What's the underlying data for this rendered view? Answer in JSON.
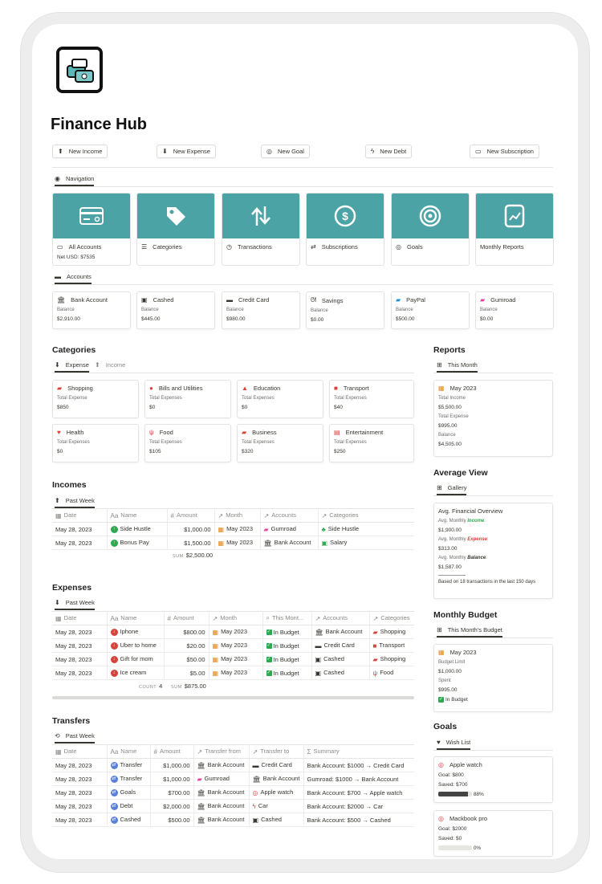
{
  "page": {
    "title": "Finance Hub"
  },
  "quick_actions": [
    {
      "label": "New Income",
      "icon": "arrow-up-circle-icon"
    },
    {
      "label": "New Expense",
      "icon": "arrow-down-circle-icon"
    },
    {
      "label": "New Goal",
      "icon": "target-icon"
    },
    {
      "label": "New Debt",
      "icon": "lightning-icon"
    },
    {
      "label": "New Subscription",
      "icon": "card-icon"
    }
  ],
  "navigation": {
    "tab": "Navigation",
    "cards": [
      {
        "title": "All Accounts",
        "sub": "Net USD:  $7535",
        "icon": "credit-card-icon"
      },
      {
        "title": "Categories",
        "sub": "",
        "icon": "tag-icon"
      },
      {
        "title": "Transactions",
        "sub": "",
        "icon": "arrows-updown-icon"
      },
      {
        "title": "Subscriptions",
        "sub": "",
        "icon": "dollar-cycle-icon"
      },
      {
        "title": "Goals",
        "sub": "",
        "icon": "target-icon"
      },
      {
        "title": "Monthly Reports",
        "sub": "",
        "icon": "report-icon"
      }
    ]
  },
  "accounts": {
    "tab": "Accounts",
    "label": "Balance",
    "items": [
      {
        "name": "Bank Account",
        "balance": "$2,910.00"
      },
      {
        "name": "Cashed",
        "balance": "$445.00"
      },
      {
        "name": "Credit Card",
        "balance": "$980.00"
      },
      {
        "name": "Savings",
        "balance": "$0.00"
      },
      {
        "name": "PayPal",
        "balance": "$500.00"
      },
      {
        "name": "Gumroad",
        "balance": "$0.00"
      }
    ]
  },
  "categories": {
    "title": "Categories",
    "tabs": [
      "Expense",
      "Income"
    ],
    "items": [
      {
        "name": "Shopping",
        "label": "Total Expense",
        "value": "$850",
        "icon": "bag-icon",
        "color": "#d9423b"
      },
      {
        "name": "Bills and Utilities",
        "label": "Total Expenses",
        "value": "$0",
        "icon": "drop-icon",
        "color": "#d9423b"
      },
      {
        "name": "Education",
        "label": "Total Expenses",
        "value": "$0",
        "icon": "graduation-cap-icon",
        "color": "#d9423b"
      },
      {
        "name": "Transport",
        "label": "Total Expenses",
        "value": "$40",
        "icon": "bus-icon",
        "color": "#d9423b"
      },
      {
        "name": "Health",
        "label": "Total Expenses",
        "value": "$0",
        "icon": "heart-icon",
        "color": "#d9423b"
      },
      {
        "name": "Food",
        "label": "Total Expenses",
        "value": "$105",
        "icon": "fork-knife-icon",
        "color": "#d9423b"
      },
      {
        "name": "Business",
        "label": "Total Expenses",
        "value": "$320",
        "icon": "briefcase-icon",
        "color": "#d9423b"
      },
      {
        "name": "Entertainment",
        "label": "Total Expenses",
        "value": "$250",
        "icon": "film-icon",
        "color": "#d9423b"
      }
    ]
  },
  "incomes": {
    "title": "Incomes",
    "tab": "Past Week",
    "columns": [
      "Date",
      "Name",
      "Amount",
      "Month",
      "Accounts",
      "Categories"
    ],
    "rows": [
      {
        "date": "May 28, 2023",
        "name": "Side Hustle",
        "amount": "$1,000.00",
        "month": "May 2023",
        "account": "Gumroad",
        "category": "Side Hustle"
      },
      {
        "date": "May 28, 2023",
        "name": "Bonus Pay",
        "amount": "$1,500.00",
        "month": "May 2023",
        "account": "Bank Account",
        "category": "Salary"
      }
    ],
    "sum_label": "SUM",
    "sum": "$2,500.00"
  },
  "expenses": {
    "title": "Expenses",
    "tab": "Past Week",
    "columns": [
      "Date",
      "Name",
      "Amount",
      "Month",
      "This Mont...",
      "Accounts",
      "Categories"
    ],
    "rows": [
      {
        "date": "May 28, 2023",
        "name": "Iphone",
        "amount": "$800.00",
        "month": "May 2023",
        "status": "In Budget",
        "account": "Bank Account",
        "category": "Shopping"
      },
      {
        "date": "May 28, 2023",
        "name": "Uber to home",
        "amount": "$20.00",
        "month": "May 2023",
        "status": "In Budget",
        "account": "Credit Card",
        "category": "Transport"
      },
      {
        "date": "May 28, 2023",
        "name": "Gift for mom",
        "amount": "$50.00",
        "month": "May 2023",
        "status": "In Budget",
        "account": "Cashed",
        "category": "Shopping"
      },
      {
        "date": "May 28, 2023",
        "name": "Ice cream",
        "amount": "$5.00",
        "month": "May 2023",
        "status": "In Budget",
        "account": "Cashed",
        "category": "Food"
      }
    ],
    "count_label": "COUNT",
    "count": "4",
    "sum_label": "SUM",
    "sum": "$875.00"
  },
  "transfers": {
    "title": "Transfers",
    "tab": "Past Week",
    "columns": [
      "Date",
      "Name",
      "Amount",
      "Transfer from",
      "Transfer to",
      "Summary"
    ],
    "rows": [
      {
        "date": "May 28, 2023",
        "name": "Transfer",
        "amount": "$1,000.00",
        "from": "Bank Account",
        "to": "Credit Card",
        "summary": "Bank Account: $1000 → Credit Card"
      },
      {
        "date": "May 28, 2023",
        "name": "Transfer",
        "amount": "$1,000.00",
        "from": "Gumroad",
        "to": "Bank Account",
        "summary": "Gumroad: $1000 → Bank Account"
      },
      {
        "date": "May 28, 2023",
        "name": "Goals",
        "amount": "$700.00",
        "from": "Bank Account",
        "to": "Apple watch",
        "summary": "Bank Account: $700 → Apple watch"
      },
      {
        "date": "May 28, 2023",
        "name": "Debt",
        "amount": "$2,000.00",
        "from": "Bank Account",
        "to": "Car",
        "summary": "Bank Account: $2000 → Car"
      },
      {
        "date": "May 28, 2023",
        "name": "Cashed",
        "amount": "$500.00",
        "from": "Bank Account",
        "to": "Cashed",
        "summary": "Bank Account: $500 → Cashed"
      }
    ]
  },
  "reports": {
    "title": "Reports",
    "tab": "This Month",
    "card": {
      "title": "May 2023",
      "income_label": "Total Income",
      "income": "$5,500.00",
      "expense_label": "Total Expense",
      "expense": "$995.00",
      "balance_label": "Balance",
      "balance": "$4,505.00"
    }
  },
  "average_view": {
    "title": "Average View",
    "tab": "Gallery",
    "card": {
      "title": "Avg. Financial Overview",
      "income_prefix": "Avg. Monthly ",
      "income_word": "Income",
      "income": "$1,900.00",
      "expense_prefix": "Avg. Monthly ",
      "expense_word": "Expense",
      "expense": "$313.00",
      "balance_prefix": "Avg. Monthly ",
      "balance_word": "Balance",
      "balance": "$1,587.00",
      "note": "Based on 18 transactions in the last 150 days"
    }
  },
  "monthly_budget": {
    "title": "Monthly Budget",
    "tab": "This Month's Budget",
    "card": {
      "title": "May 2023",
      "limit_label": "Budget Limit",
      "limit": "$1,000.00",
      "spent_label": "Spent",
      "spent": "$995.00",
      "status": "In Budget"
    }
  },
  "goals": {
    "title": "Goals",
    "tab": "Wish List",
    "items": [
      {
        "name": "Apple watch",
        "goal": "Goal: $800",
        "saved": "Saved: $700",
        "progress": 0.88,
        "progress_label": "88%"
      },
      {
        "name": "Mackbook pro",
        "goal": "Goal: $2000",
        "saved": "Saved: $0",
        "progress": 0,
        "progress_label": "0%"
      }
    ]
  },
  "colors": {
    "teal": "#4ba3a6",
    "green": "#2fa84f",
    "red": "#d9423b",
    "orange": "#e38b20"
  }
}
